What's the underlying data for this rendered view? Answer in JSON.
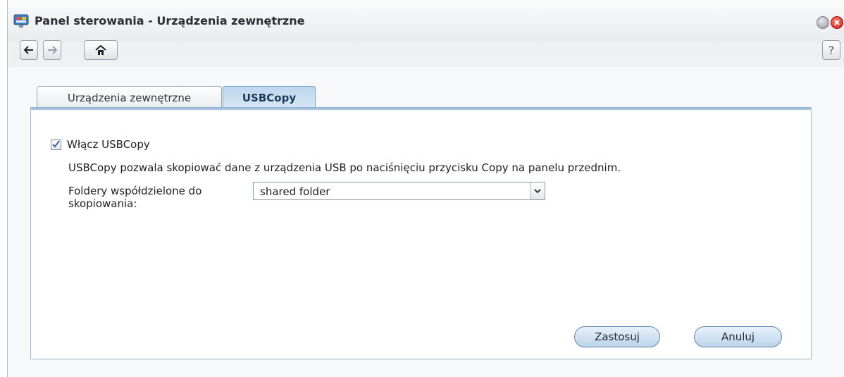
{
  "window": {
    "title": "Panel sterowania - Urządzenia zewnętrzne",
    "help_label": "?"
  },
  "tabs": [
    {
      "label": "Urządzenia zewnętrzne",
      "active": false
    },
    {
      "label": "USBCopy",
      "active": true
    }
  ],
  "usbcopy": {
    "enable_label": "Włącz USBCopy",
    "enable_checked": true,
    "description": "USBCopy pozwala skopiować dane z urządzenia USB po naciśnięciu przycisku Copy na panelu przednim.",
    "folder_label": "Foldery współdzielone do skopiowania:",
    "folder_value": "shared folder"
  },
  "buttons": {
    "apply_label": "Zastosuj",
    "cancel_label": "Anuluj"
  },
  "icons": {
    "app": "control-panel-icon",
    "back": "back-arrow-icon",
    "forward": "forward-arrow-icon",
    "home": "home-icon",
    "minimize": "minimize-icon",
    "close": "close-icon",
    "dropdown": "chevron-down-icon",
    "checkbox": "checkmark-icon"
  }
}
